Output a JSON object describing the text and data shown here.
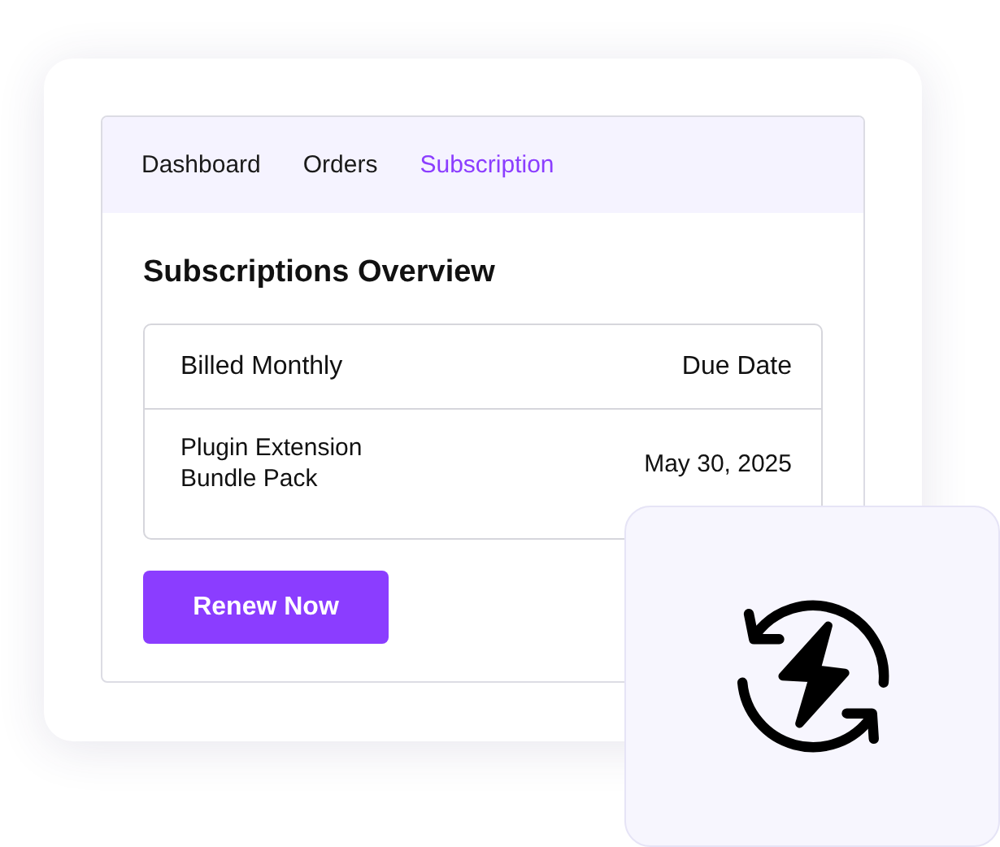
{
  "tabs": [
    {
      "label": "Dashboard",
      "selected": false
    },
    {
      "label": "Orders",
      "selected": false
    },
    {
      "label": "Subscription",
      "selected": true
    }
  ],
  "title": "Subscriptions Overview",
  "table": {
    "columns": [
      "Billed Monthly",
      "Due Date"
    ],
    "rows": [
      [
        "Plugin Extension\nBundle Pack",
        "May 30, 2025"
      ]
    ]
  },
  "button": "Renew Now"
}
